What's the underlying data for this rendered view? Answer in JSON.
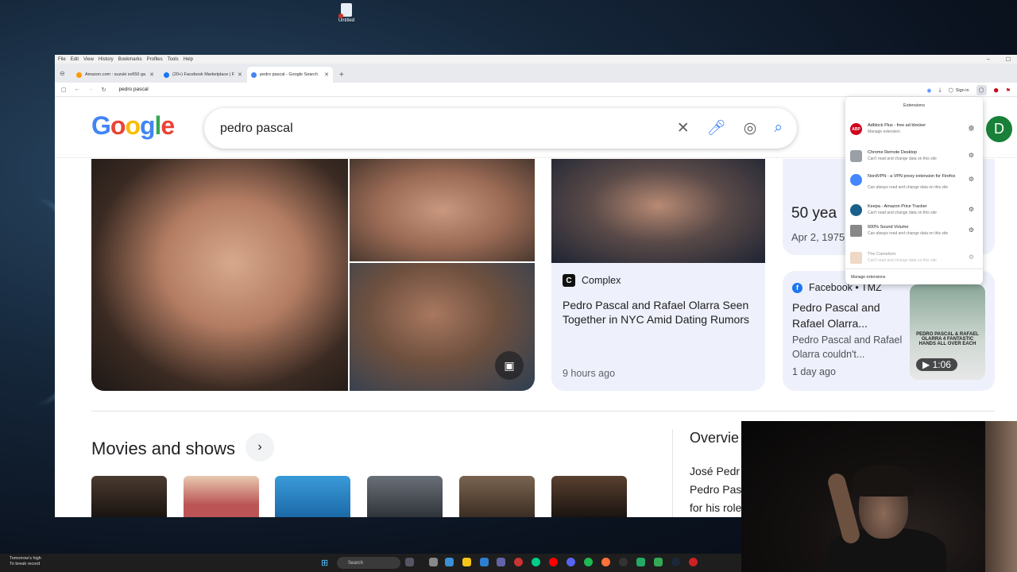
{
  "desktop": {
    "icon_label": "Untitled"
  },
  "browser": {
    "menu": [
      "File",
      "Edit",
      "View",
      "History",
      "Bookmarks",
      "Profiles",
      "Tools",
      "Help"
    ],
    "tabs": [
      {
        "label": "Amazon.com : suzuki sv650 ga",
        "color": "#ff9900"
      },
      {
        "label": "(20+) Facebook Marketplace | F",
        "color": "#1877f2"
      },
      {
        "label": "pedro pascal - Google Search",
        "color": "#4285f4",
        "active": true
      }
    ],
    "address": "pedro pascal",
    "sign_in": "Sign in"
  },
  "google": {
    "query": "pedro pascal",
    "avatar_letter": "D",
    "card_complex": {
      "source": "Complex",
      "title": "Pedro Pascal and Rafael Olarra Seen Together in NYC Amid Dating Rumors",
      "time": "9 hours ago"
    },
    "card_age": {
      "big": "50 yea",
      "date": "Apr 2, 1975"
    },
    "card_tmz": {
      "source": "Facebook • TMZ",
      "title": "Pedro Pascal and Rafael Olarra...",
      "snippet": "Pedro Pascal and Rafael Olarra couldn't...",
      "time": "1 day ago",
      "duration": "1:06",
      "thumb_caption": "PEDRO PASCAL & RAFAEL OLARRA 4 FANTASTIC HANDS ALL OVER EACH"
    },
    "movies_title": "Movies and shows",
    "overview_title": "Overvie",
    "overview_text": "José Pedr Pedro Pas for his role"
  },
  "extensions": {
    "header": "Extensions",
    "items": [
      {
        "name": "Adblock Plus - free ad blocker",
        "sub": "Manage extension",
        "color": "#d0021b",
        "icon": "ABP"
      },
      {
        "name": "Chrome Remote Desktop",
        "sub": "Can't read and change data on this site",
        "color": "#9aa0a6",
        "icon": ""
      },
      {
        "name": "NordVPN - a VPN proxy extension for Firefox",
        "sub": "Can always read and change data on this site",
        "color": "#4687ff",
        "icon": ""
      },
      {
        "name": "Keepa - Amazon Price Tracker",
        "sub": "Can't read and change data on this site",
        "color": "#1a5f8a",
        "icon": ""
      },
      {
        "name": "600% Sound Volume",
        "sub": "Can always read and change data on this site",
        "color": "#888888",
        "icon": ""
      },
      {
        "name": "The Camelizer",
        "sub": "Can't read and change data on this site",
        "color": "#e3b28e",
        "icon": ""
      }
    ],
    "manage": "Manage extensions"
  },
  "taskbar": {
    "weather1": "Tomorrow's high",
    "weather2": "To break record",
    "search": "Search"
  }
}
